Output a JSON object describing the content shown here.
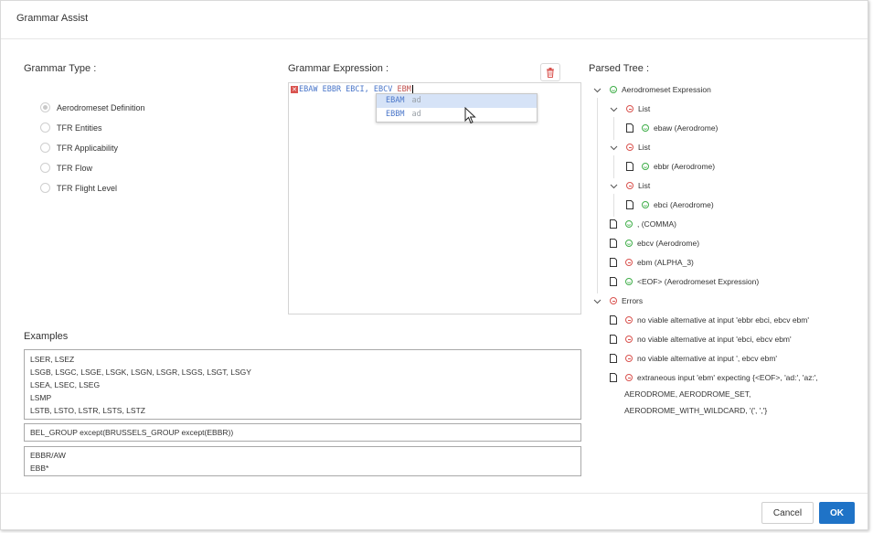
{
  "dialog": {
    "title": "Grammar Assist"
  },
  "grammar_type": {
    "label": "Grammar Type :",
    "selected": "Aerodromeset Definition",
    "options": [
      "Aerodromeset Definition",
      "TFR Entities",
      "TFR Applicability",
      "TFR Flow",
      "TFR Flight Level"
    ]
  },
  "expression": {
    "label": "Grammar Expression :",
    "error_icon": "x-mark-icon",
    "valid_text": "EBAW EBBR EBCI, EBCV ",
    "invalid_text": "EBM",
    "suggestions": [
      {
        "name": "EBAM",
        "kind": "ad"
      },
      {
        "name": "EBBM",
        "kind": "ad"
      }
    ],
    "clear_icon": "trash-icon"
  },
  "tree": {
    "label": "Parsed Tree :",
    "nodes": [
      "Aerodromeset Expression",
      "List",
      "ebaw (Aerodrome)",
      "List",
      "ebbr (Aerodrome)",
      "List",
      "ebci (Aerodrome)",
      ", (COMMA)",
      "ebcv (Aerodrome)",
      "ebm (ALPHA_3)",
      "<EOF> (Aerodromeset Expression)",
      "Errors",
      "no viable alternative at input 'ebbr ebci, ebcv ebm'",
      "no viable alternative at input 'ebci, ebcv ebm'",
      "no viable alternative at input ', ebcv ebm'",
      "extraneous input 'ebm' expecting {<EOF>, 'ad:', 'az:',",
      "AERODROME, AERODROME_SET,",
      "AERODROME_WITH_WILDCARD, '(', ','}"
    ]
  },
  "examples": {
    "label": "Examples",
    "groups": [
      [
        "LSER, LSEZ",
        "LSGB, LSGC, LSGE, LSGK, LSGN, LSGR, LSGS, LSGT, LSGY",
        "LSEA, LSEC, LSEG",
        "LSMP",
        "LSTB, LSTO, LSTR, LSTS, LSTZ"
      ],
      [
        "BEL_GROUP except(BRUSSELS_GROUP except(EBBR))"
      ],
      [
        "EBBR/AW",
        "EBB*"
      ]
    ]
  },
  "footer": {
    "cancel": "Cancel",
    "ok": "OK"
  },
  "colors": {
    "primary": "#1f73c7",
    "error": "#d9534f",
    "success": "#3fae49",
    "keyword": "#4a76c9"
  }
}
